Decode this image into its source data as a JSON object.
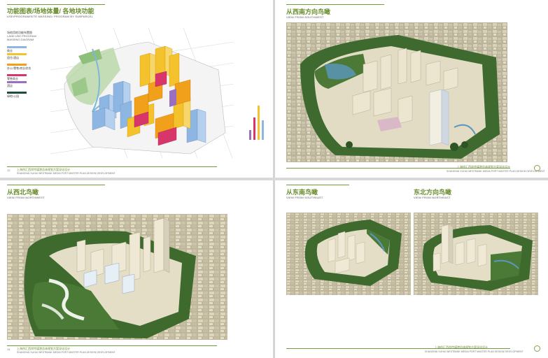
{
  "pages": {
    "tl": {
      "title": "功能图表/场地体量/ 各地块功能",
      "subtitle": "USE/PROGRAM/SITE MASSING/ PROGRAM BY SUBPARCEL",
      "legend_head": [
        "场地用地功能布置图",
        "LAND USE PROGRAM",
        "MASSING DIAGRAM"
      ],
      "legend": [
        {
          "label": "商业",
          "en": "Commercial",
          "color": "#8eb6e3"
        },
        {
          "label": "居住/酒店",
          "en": "Residential / Hotel",
          "color": "#f3c22c"
        },
        {
          "label": "办公/零售/商业综合",
          "en": "Office / Retail / Commercial",
          "color": "#f0a01a"
        },
        {
          "label": "零售商业",
          "en": "Retail",
          "color": "#d8356a"
        },
        {
          "label": "酒店",
          "en": "Hotel",
          "color": "#9a6fc0"
        },
        {
          "label": "绿地/公园",
          "en": "Green / Park",
          "color": "#1d4d3e"
        }
      ],
      "bar_chart": [
        {
          "color": "#9a6fc0",
          "height": 0.2
        },
        {
          "color": "#d8356a",
          "height": 0.45
        },
        {
          "color": "#f3c22c",
          "height": 0.7
        },
        {
          "color": "#8eb6e3",
          "height": 0.4
        }
      ],
      "footer_cn": "上海徐汇西岸传媒港总体规划方案深化设计",
      "footer_en": "SHANGHAI XUHUI WESTBANK MEDIA PORT MASTER PLAN DESIGN DEVELOPMENT",
      "page_no": "12"
    },
    "tr": {
      "title": "从西南方向鸟瞰",
      "subtitle": "VIEW FROM SOUTHWEST",
      "footer_cn": "上海徐汇西岸传媒港总体规划方案深化设计",
      "footer_en": "SHANGHAI XUHUI WESTBANK MEDIA PORT MASTER PLAN DESIGN DEVELOPMENT",
      "page_no": "13"
    },
    "bl": {
      "title": "从西北鸟瞰",
      "subtitle": "VIEW FROM NORTHWEST",
      "footer_cn": "上海徐汇西岸传媒港总体规划方案深化设计",
      "footer_en": "SHANGHAI XUHUI WESTBANK MEDIA PORT MASTER PLAN DESIGN DEVELOPMENT",
      "page_no": "14"
    },
    "br": {
      "title_left": "从东南鸟瞰",
      "subtitle_left": "VIEW FROM SOUTHEAST",
      "title_right": "东北方向鸟瞰",
      "subtitle_right": "VIEW FROM NORTHEAST",
      "footer_cn": "上海徐汇西岸传媒港总体规划方案深化设计",
      "footer_en": "SHANGHAI XUHUI WESTBANK MEDIA PORT MASTER PLAN DESIGN DEVELOPMENT",
      "page_no": "15"
    }
  }
}
